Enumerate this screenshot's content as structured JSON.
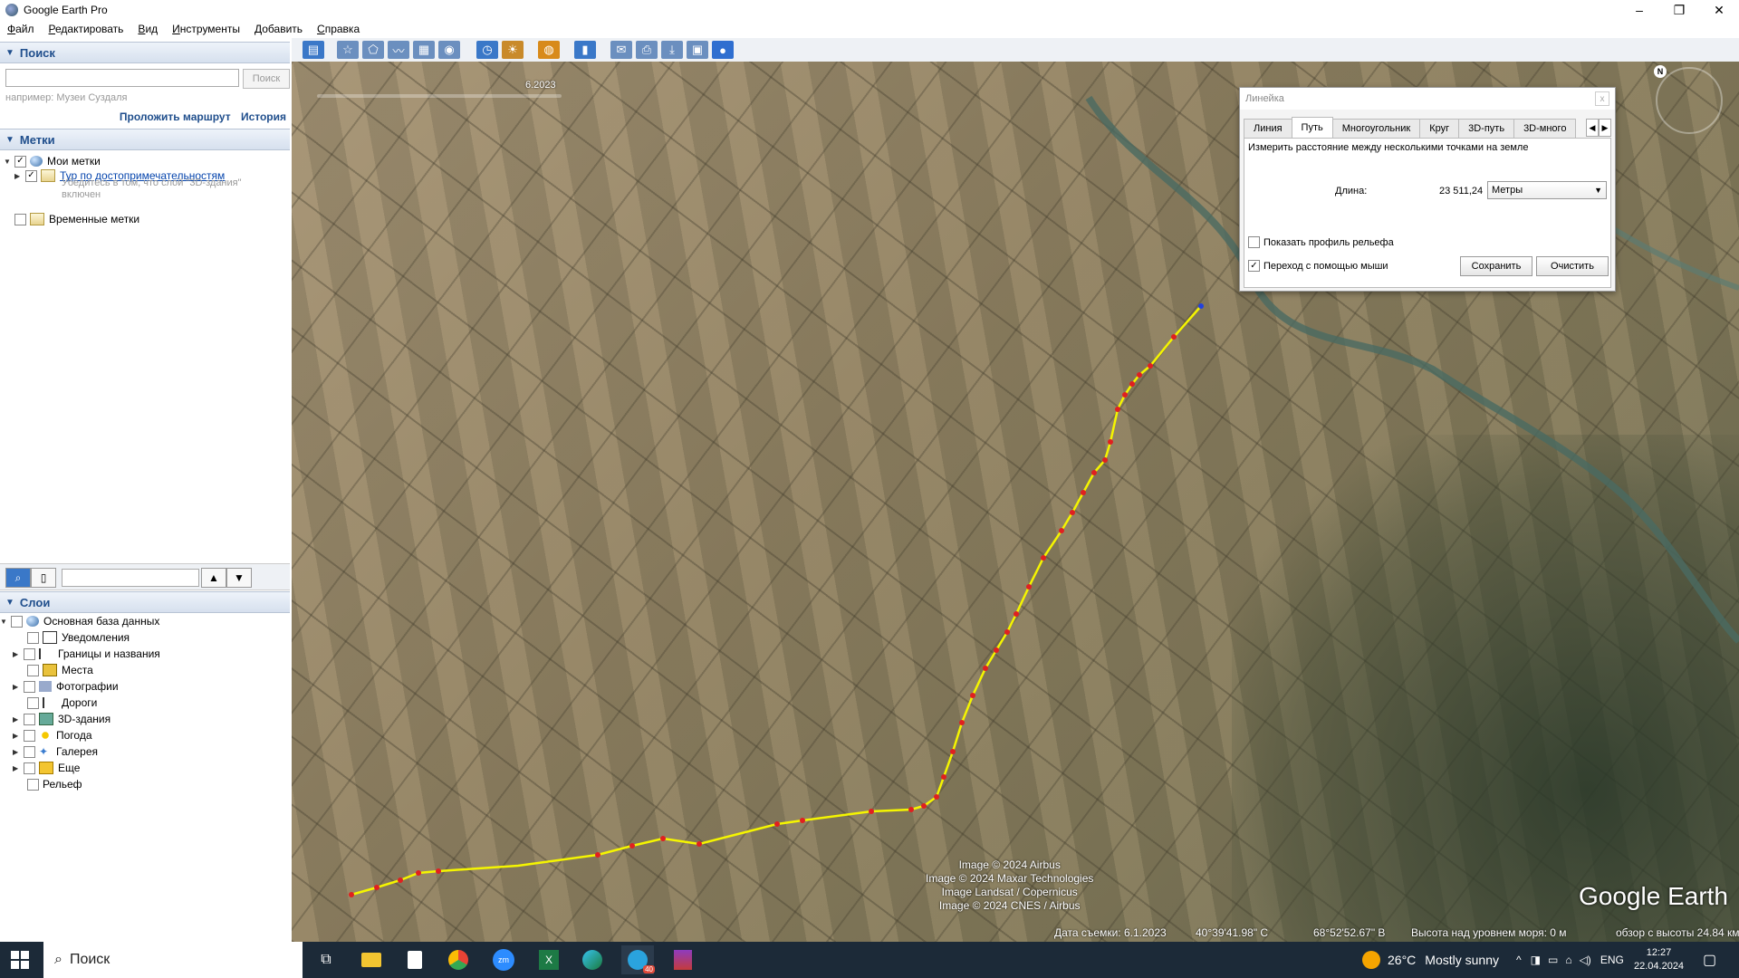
{
  "window": {
    "title": "Google Earth Pro",
    "minimize": "–",
    "maximize": "❐",
    "close": "✕"
  },
  "menu": [
    "Файл",
    "Редактировать",
    "Вид",
    "Инструменты",
    "Добавить",
    "Справка"
  ],
  "search_panel": {
    "header": "Поиск",
    "input_value": "",
    "button": "Поиск",
    "hint": "например: Музеи Суздаля",
    "route_link": "Проложить маршрут",
    "history_link": "История"
  },
  "places_panel": {
    "header": "Метки",
    "items": [
      {
        "label": "Мои метки",
        "checked": true
      },
      {
        "label": "Тур по достопримечательностям",
        "checked": true
      },
      {
        "label": "Убедитесь в том, что слой \"3D-здания\" включен"
      },
      {
        "label": "Временные метки",
        "checked": false
      }
    ]
  },
  "layers_panel": {
    "header": "Слои",
    "items": [
      {
        "label": "Основная база данных"
      },
      {
        "label": "Уведомления"
      },
      {
        "label": "Границы и названия"
      },
      {
        "label": "Места"
      },
      {
        "label": "Фотографии"
      },
      {
        "label": "Дороги"
      },
      {
        "label": "3D-здания"
      },
      {
        "label": "Погода"
      },
      {
        "label": "Галерея"
      },
      {
        "label": "Еще"
      },
      {
        "label": "Рельеф"
      }
    ]
  },
  "map": {
    "time_slider_label": "6.2023",
    "credits": [
      "Image © 2024 Airbus",
      "Image © 2024 Maxar Technologies",
      "Image Landsat / Copernicus",
      "Image © 2024 CNES / Airbus"
    ],
    "logo": "Google Earth",
    "compass_label": "N",
    "status": {
      "date": "Дата съемки: 6.1.2023",
      "lat": "40°39'41.98\" С",
      "lon": "68°52'52.67\" В",
      "elevation": "Высота над уровнем моря:   0 м",
      "eye_alt": "обзор с высоты   24.84 км"
    }
  },
  "ruler": {
    "title": "Линейка",
    "close": "x",
    "tabs": [
      "Линия",
      "Путь",
      "Многоугольник",
      "Круг",
      "3D-путь",
      "3D-много"
    ],
    "active_tab": "Путь",
    "description": "Измерить расстояние между несколькими точками на земле",
    "length_label": "Длина:",
    "length_value": "23 511,24",
    "units": "Метры",
    "show_profile": "Показать профиль рельефа",
    "mouse_nav": "Переход с помощью мыши",
    "save": "Сохранить",
    "clear": "Очистить"
  },
  "taskbar": {
    "search": "Поиск",
    "temperature": "26°C",
    "weather": "Mostly sunny",
    "lang": "ENG",
    "time": "12:27",
    "date": "22.04.2024",
    "telegram_badge": "40"
  }
}
